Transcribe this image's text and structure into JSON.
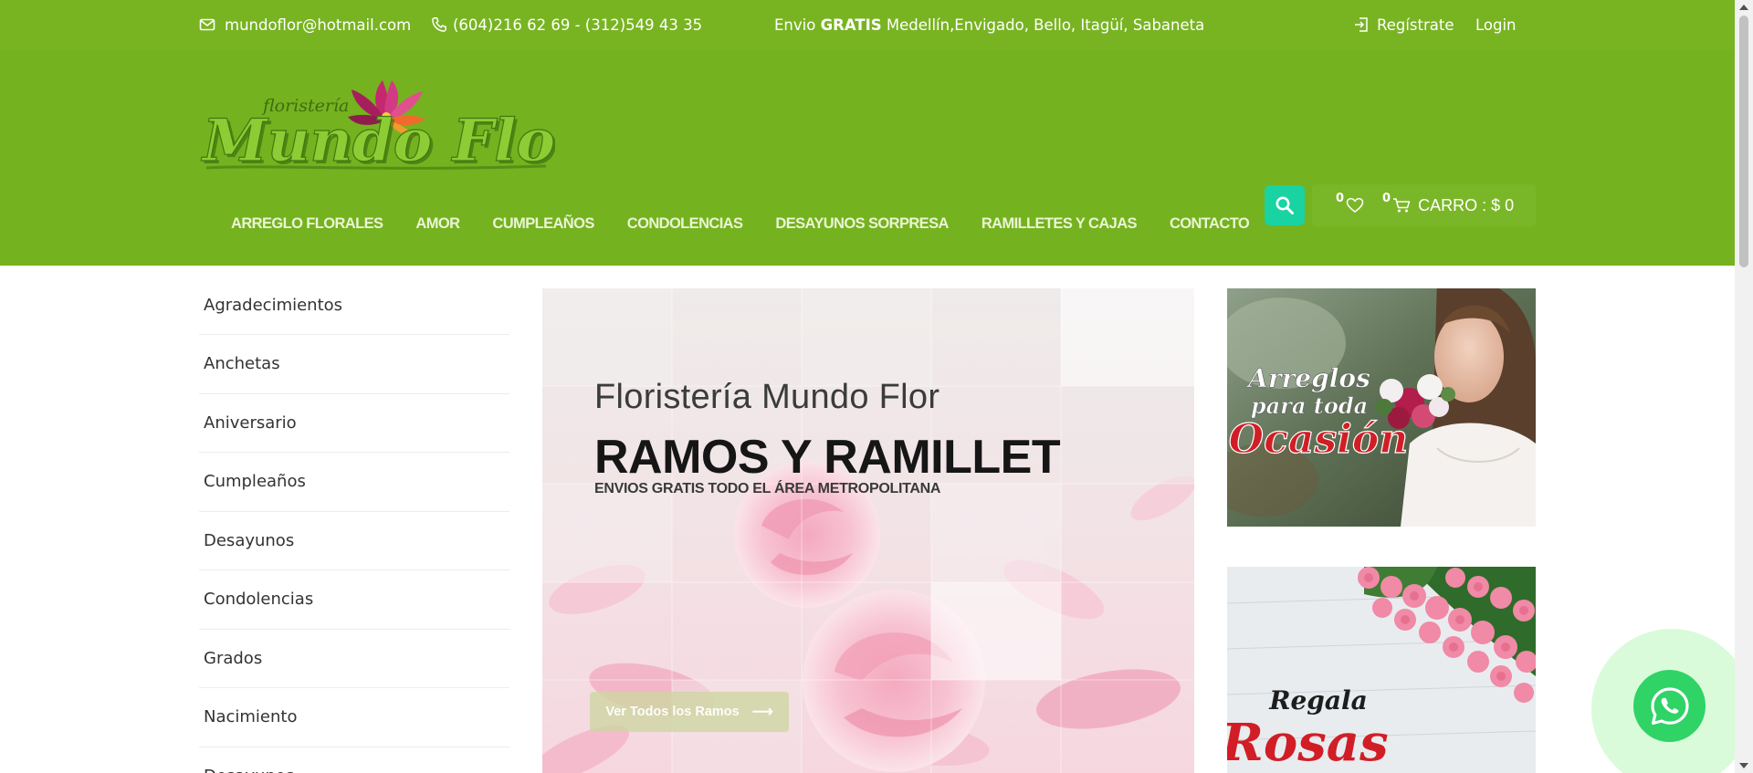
{
  "topbar": {
    "email": "mundoflor@hotmail.com",
    "phone": "(604)216 62 69 - (312)549 43 35",
    "shipping_prefix": "Envio",
    "shipping_bold": "GRATIS",
    "shipping_areas": "Medellín,Envigado, Bello, Itagüí, Sabaneta",
    "register": "Regístrate",
    "login": "Login",
    "icons": [
      "mail-icon",
      "phone-icon",
      "register-icon"
    ]
  },
  "header": {
    "logo_small_text": "floristería",
    "logo_text": "Mundo Flor",
    "nav": [
      "ARREGLO FLORALES",
      "AMOR",
      "CUMPLEAÑOS",
      "CONDOLENCIAS",
      "DESAYUNOS SORPRESA",
      "RAMILLETES Y CAJAS",
      "CONTACTO"
    ],
    "wishlist_count": "0",
    "cart_count": "0",
    "cart_label": "CARRO : $ 0",
    "accent_color": "#75b21f",
    "search_color": "#19d3a2"
  },
  "sidebar": {
    "categories": [
      "Agradecimientos",
      "Anchetas",
      "Aniversario",
      "Cumpleaños",
      "Desayunos",
      "Condolencias",
      "Grados",
      "Nacimiento",
      "Desayunos"
    ]
  },
  "hero": {
    "subtitle": "Floristería Mundo Flor",
    "title": "RAMOS Y RAMILLETES",
    "tagline": "ENVIOS GRATIS TODO EL ÁREA METROPOLITANA",
    "cta": "Ver Todos los Ramos",
    "cta_arrow": "⟶"
  },
  "banners": {
    "banner1": {
      "line1": "Arreglos",
      "line2": "para toda",
      "line3": "Ocasión"
    },
    "banner2": {
      "line1": "Regala",
      "line2": "Rosas"
    }
  },
  "whatsapp": {
    "icon": "whatsapp-icon",
    "color": "#2fd366"
  }
}
